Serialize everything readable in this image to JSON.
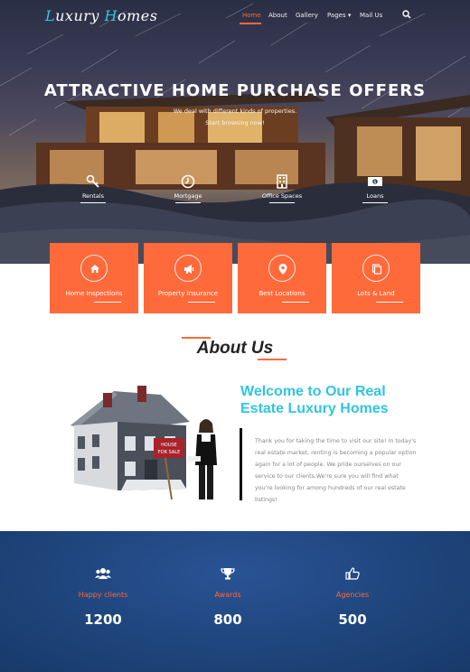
{
  "brand": {
    "logo_part1": "L",
    "logo_part2": "uxury ",
    "logo_part3": "H",
    "logo_part4": "omes",
    "accent_color": "#2fc6e0"
  },
  "nav": {
    "items": [
      "Home",
      "About",
      "Gallery",
      "Pages",
      "Mail Us"
    ],
    "active": "Home",
    "pages_caret": "▾"
  },
  "hero": {
    "title": "ATTRACTIVE HOME PURCHASE OFFERS",
    "subtitle_line1": "We deal with different kinds of properties.",
    "subtitle_line2": "Start browsing now!",
    "features": [
      {
        "label": "Rentals",
        "icon": "key-icon"
      },
      {
        "label": "Mortgage",
        "icon": "clock-icon"
      },
      {
        "label": "Office Spaces",
        "icon": "building-icon"
      },
      {
        "label": "Loans",
        "icon": "money-icon"
      }
    ]
  },
  "services": [
    {
      "label": "Home Inspections",
      "icon": "home-icon"
    },
    {
      "label": "Property Insurance",
      "icon": "megaphone-icon"
    },
    {
      "label": "Best Locations",
      "icon": "map-pin-icon"
    },
    {
      "label": "Lots & Land",
      "icon": "copy-icon"
    }
  ],
  "about": {
    "title": "About Us",
    "welcome_line1": "Welcome to Our Real",
    "welcome_line2": "Estate Luxury Homes",
    "text": "Thank you for taking the time to visit our site! In today's real estate market, renting is becoming a popular option again for a lot of people. We pride ourselves on our service to our clients.We're sure you will find what you're looking for among hundreds of our real estate listings!",
    "sign_line1": "HOUSE",
    "sign_line2": "FOR SALE"
  },
  "stats": [
    {
      "label": "Happy clients",
      "value": "1200",
      "icon": "users-icon"
    },
    {
      "label": "Awards",
      "value": "800",
      "icon": "trophy-icon"
    },
    {
      "label": "Agencies",
      "value": "500",
      "icon": "thumbs-up-icon"
    }
  ],
  "colors": {
    "accent": "#ff6a3a",
    "stats_bg": "#1f467e",
    "cyan": "#2fc6e0"
  }
}
